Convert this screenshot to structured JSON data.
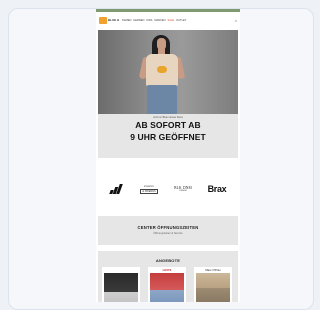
{
  "header": {
    "logo_text": "BLUE HOUSE",
    "nav": [
      "DAMEN",
      "HERREN",
      "KIDS",
      "MARKEN",
      "SALE",
      "OUTLET",
      "ANGEBOTE"
    ],
    "icons": [
      "search-icon",
      "heart-icon",
      "bag-icon"
    ],
    "accent_color": "#7f9a73"
  },
  "hero": {
    "kicker": "Jetzt im Blue House Store",
    "title_line1": "AB SOFORT AB",
    "title_line2": "9 UHR GEÖFFNET"
  },
  "brands": {
    "adidas": "adidas",
    "lovers": "Lovers",
    "lovers_sub": "& FRIENDS",
    "blk": "BLK DNM",
    "blk_sub": "DENIM",
    "brax": "Brax"
  },
  "center": {
    "title": "CENTER ÖFFNUNGSZEITEN",
    "subtitle": "Öffnungszeiten & Service"
  },
  "offers": {
    "title": "ANGEBOTE",
    "tiles": [
      {
        "label": "",
        "image": "model-dark-top"
      },
      {
        "label": "LEVI'S",
        "image": "model-red-top-jeans"
      },
      {
        "label": "Marc O'Polo",
        "image": "model-jacket"
      }
    ]
  }
}
